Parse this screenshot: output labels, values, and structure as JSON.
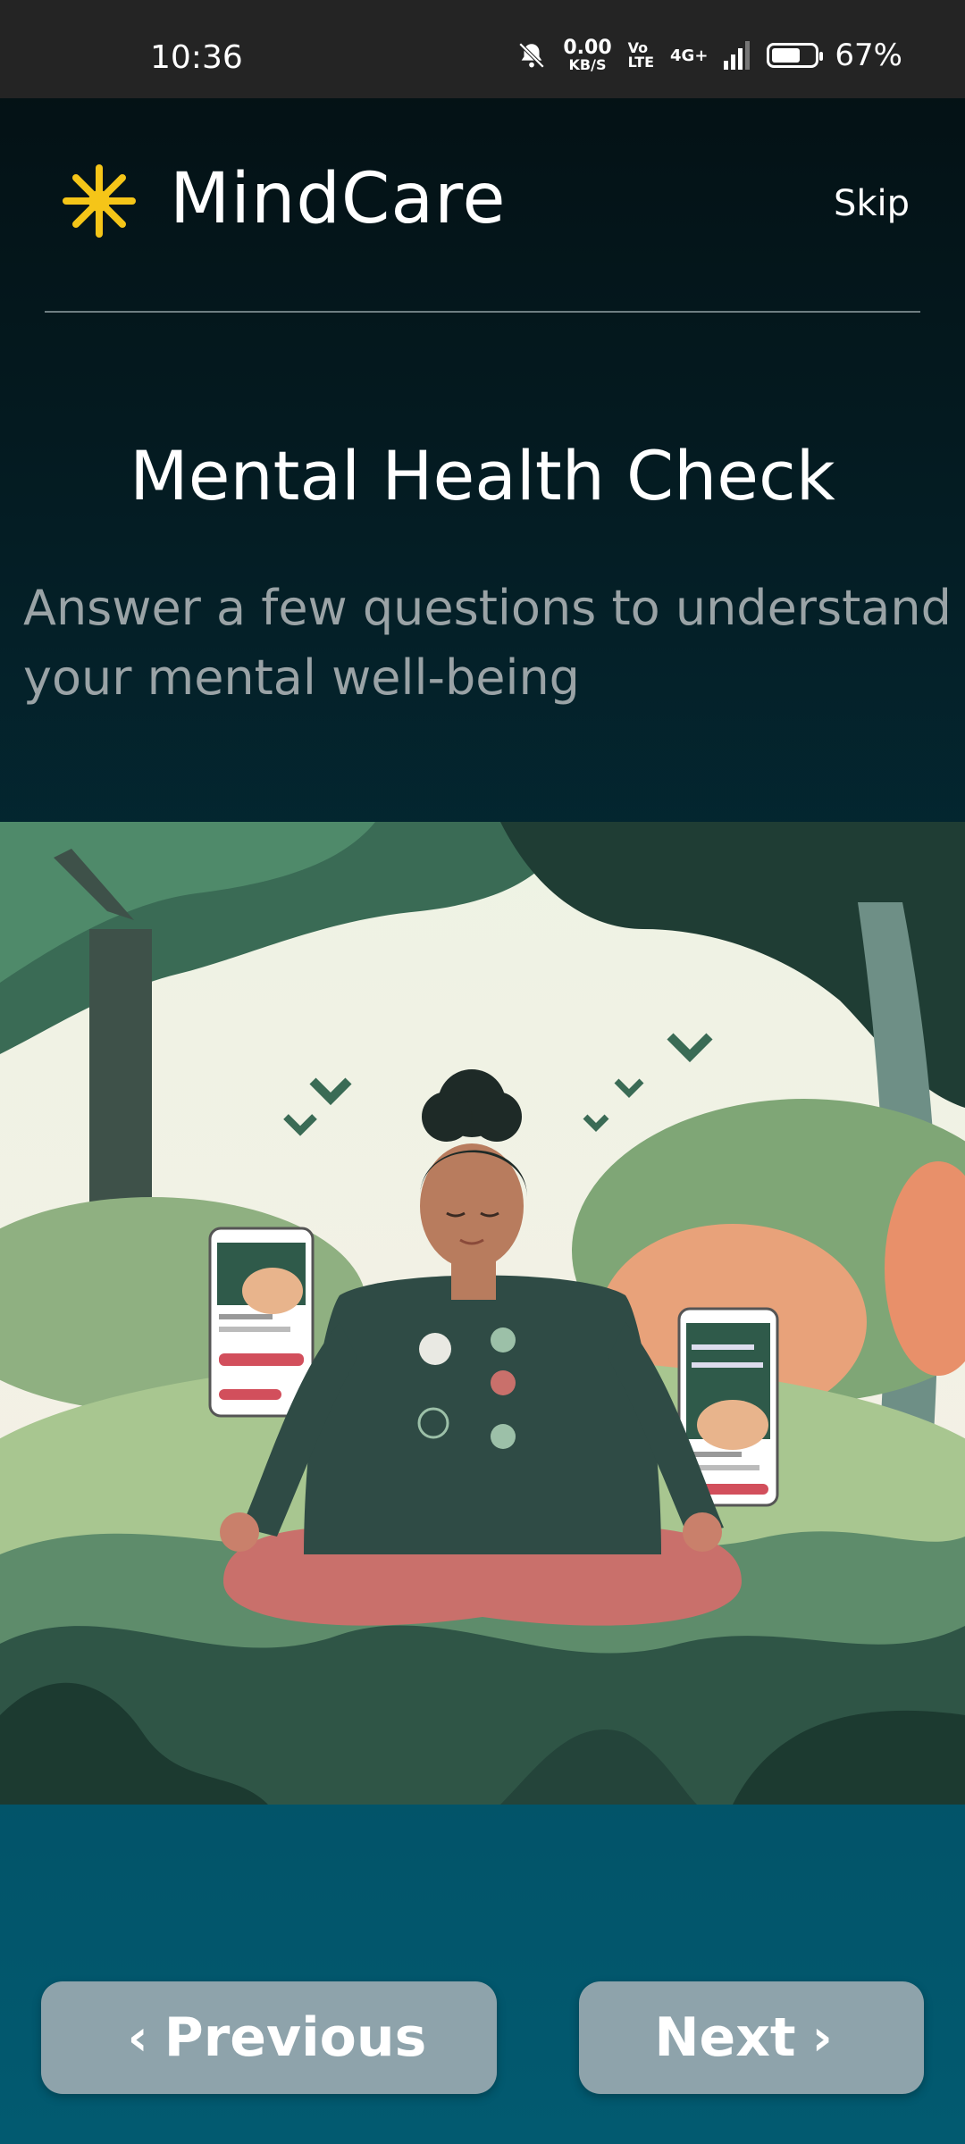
{
  "status_bar": {
    "time": "10:36",
    "net_speed": "0.00",
    "net_unit": "KB/S",
    "volte_top": "Vo",
    "volte_bottom": "LTE",
    "network": "4G+",
    "battery_percent": "67%",
    "battery_level": 0.67,
    "icons": [
      "mute-bell-icon",
      "signal-icon",
      "battery-icon"
    ]
  },
  "header": {
    "app_name": "MindCare",
    "logo_icon": "asterisk-sun-icon",
    "logo_color": "#f5c518",
    "skip_label": "Skip"
  },
  "content": {
    "title": "Mental Health Check",
    "subtitle": "Answer a few questions to understand your mental well-being"
  },
  "illustration": {
    "icon": "meditation-illustration"
  },
  "buttons": {
    "previous_label": "Previous",
    "next_label": "Next",
    "color": "#8ea3ab"
  }
}
